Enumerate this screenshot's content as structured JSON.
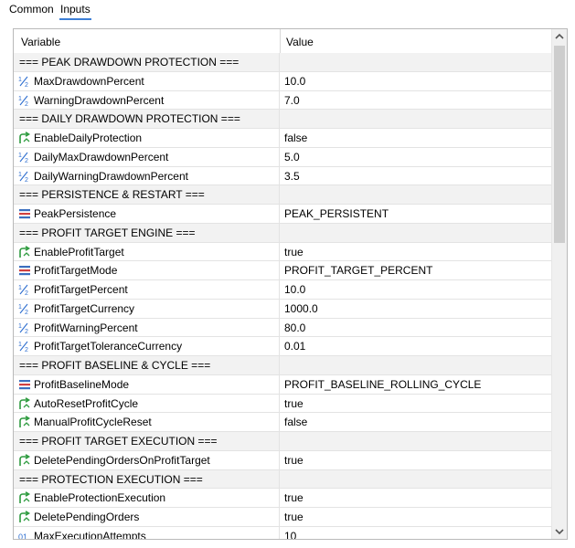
{
  "tabs": [
    {
      "label": "Common",
      "active": false
    },
    {
      "label": "Inputs",
      "active": true
    }
  ],
  "table": {
    "columns": {
      "variable": "Variable",
      "value": "Value"
    },
    "rows": [
      {
        "type": "section",
        "name": "=== PEAK DRAWDOWN PROTECTION ===",
        "value": ""
      },
      {
        "type": "double",
        "icon": "fraction-half-icon",
        "name": "MaxDrawdownPercent",
        "value": "10.0"
      },
      {
        "type": "double",
        "icon": "fraction-half-icon",
        "name": "WarningDrawdownPercent",
        "value": "7.0"
      },
      {
        "type": "section",
        "name": "=== DAILY DRAWDOWN PROTECTION ===",
        "value": ""
      },
      {
        "type": "bool",
        "icon": "bool-arrow-icon",
        "name": "EnableDailyProtection",
        "value": "false"
      },
      {
        "type": "double",
        "icon": "fraction-half-icon",
        "name": "DailyMaxDrawdownPercent",
        "value": "5.0"
      },
      {
        "type": "double",
        "icon": "fraction-half-icon",
        "name": "DailyWarningDrawdownPercent",
        "value": "3.5"
      },
      {
        "type": "section",
        "name": "=== PERSISTENCE & RESTART ===",
        "value": ""
      },
      {
        "type": "enum",
        "icon": "enum-list-icon",
        "name": "PeakPersistence",
        "value": "PEAK_PERSISTENT"
      },
      {
        "type": "section",
        "name": "=== PROFIT TARGET ENGINE ===",
        "value": ""
      },
      {
        "type": "bool",
        "icon": "bool-arrow-icon",
        "name": "EnableProfitTarget",
        "value": "true"
      },
      {
        "type": "enum",
        "icon": "enum-list-icon",
        "name": "ProfitTargetMode",
        "value": "PROFIT_TARGET_PERCENT"
      },
      {
        "type": "double",
        "icon": "fraction-half-icon",
        "name": "ProfitTargetPercent",
        "value": "10.0"
      },
      {
        "type": "double",
        "icon": "fraction-half-icon",
        "name": "ProfitTargetCurrency",
        "value": "1000.0"
      },
      {
        "type": "double",
        "icon": "fraction-half-icon",
        "name": "ProfitWarningPercent",
        "value": "80.0"
      },
      {
        "type": "double",
        "icon": "fraction-half-icon",
        "name": "ProfitTargetToleranceCurrency",
        "value": "0.01"
      },
      {
        "type": "section",
        "name": "=== PROFIT BASELINE & CYCLE ===",
        "value": ""
      },
      {
        "type": "enum",
        "icon": "enum-list-icon",
        "name": "ProfitBaselineMode",
        "value": "PROFIT_BASELINE_ROLLING_CYCLE"
      },
      {
        "type": "bool",
        "icon": "bool-arrow-icon",
        "name": "AutoResetProfitCycle",
        "value": "true"
      },
      {
        "type": "bool",
        "icon": "bool-arrow-icon",
        "name": "ManualProfitCycleReset",
        "value": "false"
      },
      {
        "type": "section",
        "name": "=== PROFIT TARGET EXECUTION ===",
        "value": ""
      },
      {
        "type": "bool",
        "icon": "bool-arrow-icon",
        "name": "DeletePendingOrdersOnProfitTarget",
        "value": "true"
      },
      {
        "type": "section",
        "name": "=== PROTECTION EXECUTION ===",
        "value": ""
      },
      {
        "type": "bool",
        "icon": "bool-arrow-icon",
        "name": "EnableProtectionExecution",
        "value": "true"
      },
      {
        "type": "bool",
        "icon": "bool-arrow-icon",
        "name": "DeletePendingOrders",
        "value": "true"
      },
      {
        "type": "int",
        "icon": "integer-icon",
        "name": "MaxExecutionAttempts",
        "value": "10"
      }
    ]
  },
  "scrollbar": {
    "up_icon": "chevron-up-icon",
    "down_icon": "chevron-down-icon",
    "position_fraction": 0.0
  },
  "colors": {
    "double_icon": "#2f6fd0",
    "bool_icon": "#2e9b3f",
    "enum_icon": "#3b6fbf",
    "tab_underline": "#3d7fd6"
  }
}
